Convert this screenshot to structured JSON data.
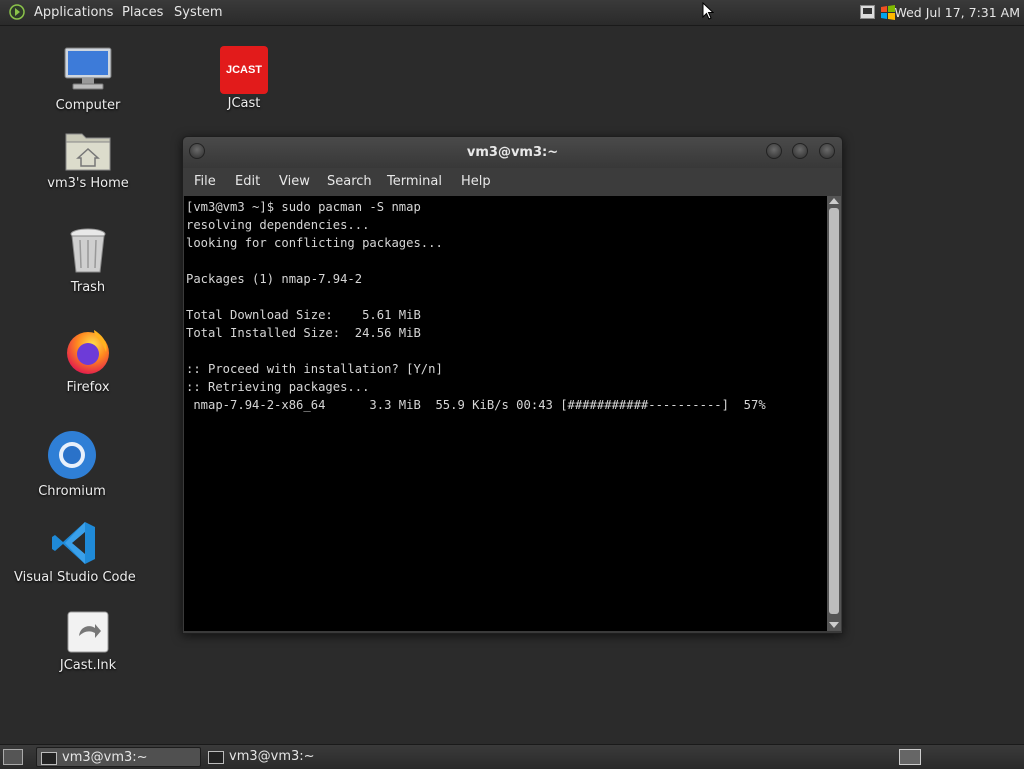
{
  "top_panel": {
    "menus": [
      "Applications",
      "Places",
      "System"
    ],
    "clock": "Wed Jul 17,  7:31 AM"
  },
  "desktop_icons": [
    {
      "label": "Computer",
      "icon": "computer-icon"
    },
    {
      "label": "JCast",
      "icon": "jcast-icon",
      "icon_text": "JCAST"
    },
    {
      "label": "vm3's Home",
      "icon": "home-folder-icon"
    },
    {
      "label": "Trash",
      "icon": "trash-icon"
    },
    {
      "label": "Firefox",
      "icon": "firefox-icon"
    },
    {
      "label": "Chromium",
      "icon": "chromium-icon"
    },
    {
      "label": "Visual Studio Code",
      "icon": "vscode-icon"
    },
    {
      "label": "JCast.lnk",
      "icon": "shortcut-icon"
    }
  ],
  "terminal": {
    "title": "vm3@vm3:~",
    "menu": [
      "File",
      "Edit",
      "View",
      "Search",
      "Terminal",
      "Help"
    ],
    "lines": [
      "[vm3@vm3 ~]$ sudo pacman -S nmap",
      "resolving dependencies...",
      "looking for conflicting packages...",
      "",
      "Packages (1) nmap-7.94-2",
      "",
      "Total Download Size:    5.61 MiB",
      "Total Installed Size:  24.56 MiB",
      "",
      ":: Proceed with installation? [Y/n]",
      ":: Retrieving packages...",
      " nmap-7.94-2-x86_64      3.3 MiB  55.9 KiB/s 00:43 [###########----------]  57%"
    ]
  },
  "taskbar": {
    "tasks": [
      {
        "label": "vm3@vm3:~",
        "active": true
      },
      {
        "label": "vm3@vm3:~",
        "active": false
      }
    ]
  },
  "colors": {
    "desktop_bg": "#2b2b2b",
    "terminal_bg": "#000000",
    "terminal_fg": "#d6d6d6",
    "jcast_red": "#e21b1b"
  }
}
